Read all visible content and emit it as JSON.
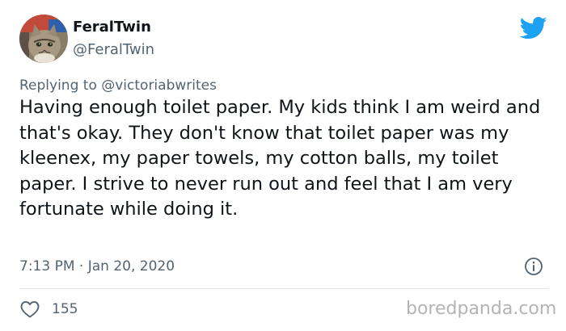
{
  "tweet": {
    "display_name": "FeralTwin",
    "handle": "@FeralTwin",
    "reply_prefix": "Replying to",
    "reply_to": "@victoriabwrites",
    "body": "Having enough toilet paper. My kids think I am weird and that's okay. They don't know that toilet paper was my kleenex, my paper towels, my cotton balls, my toilet paper. I strive to never run out and feel that I am very fortunate while doing it.",
    "timestamp": "7:13 PM · Jan 20, 2020",
    "like_count": "155"
  },
  "icons": {
    "brand": "twitter-bird-icon",
    "info": "info-icon",
    "like": "heart-icon"
  },
  "colors": {
    "brand": "#1da1f2",
    "text_primary": "#0f1419",
    "text_secondary": "#536471"
  },
  "watermark": "boredpanda.com"
}
